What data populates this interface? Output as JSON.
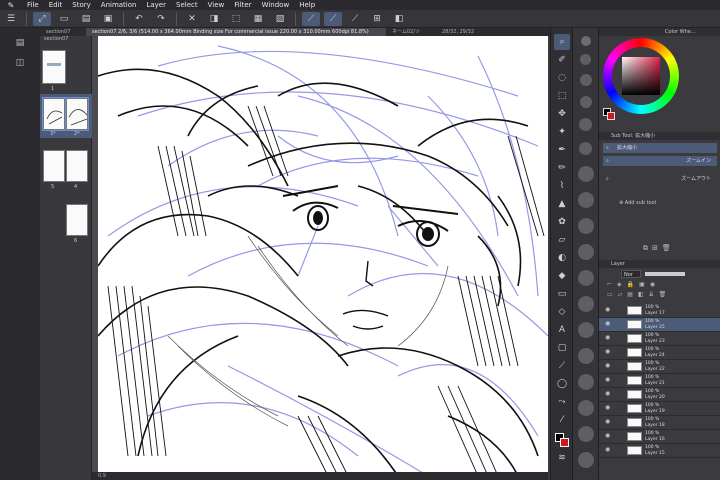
{
  "menu": [
    "File",
    "Edit",
    "Story",
    "Animation",
    "Layer",
    "Select",
    "View",
    "Filter",
    "Window",
    "Help"
  ],
  "tabs": [
    {
      "label": "section07",
      "active": false
    },
    {
      "label": "section07 2/6, 3/6 (514.00 x 364.00mm Binding size For commercial issue 220.00 x 310.00mm 600dpi 81.8%)",
      "active": true
    },
    {
      "label": "ネーム02/ソ",
      "active": false
    },
    {
      "label": "28/32, 29/32",
      "active": false
    }
  ],
  "pages": {
    "label": "section07",
    "numbers": [
      "1",
      "3*",
      "2*",
      "5",
      "4",
      "6"
    ]
  },
  "color_wheel": {
    "title": "Color Whe...",
    "accent": "#c8324a"
  },
  "subtool": {
    "title": "Sub Tool: 拡大縮小",
    "items": [
      "拡大縮小",
      "ズームイン",
      "ズームアウト"
    ],
    "add_label": "Add sub tool"
  },
  "layer_panel": {
    "title": "Layer",
    "blend": "Nor",
    "layers": [
      {
        "opacity": "100 %",
        "name": "Layer 17",
        "selected": false
      },
      {
        "opacity": "100 %",
        "name": "Layer 25",
        "selected": true
      },
      {
        "opacity": "100 %",
        "name": "Layer 23",
        "selected": false
      },
      {
        "opacity": "100 %",
        "name": "Layer 24",
        "selected": false
      },
      {
        "opacity": "100 %",
        "name": "Layer 22",
        "selected": false
      },
      {
        "opacity": "100 %",
        "name": "Layer 21",
        "selected": false
      },
      {
        "opacity": "100 %",
        "name": "Layer 20",
        "selected": false
      },
      {
        "opacity": "100 %",
        "name": "Layer 19",
        "selected": false
      },
      {
        "opacity": "100 %",
        "name": "Layer 18",
        "selected": false
      },
      {
        "opacity": "100 %",
        "name": "Layer 16",
        "selected": false
      },
      {
        "opacity": "100 %",
        "name": "Layer 15",
        "selected": false
      }
    ]
  },
  "statusbar": "0.9"
}
